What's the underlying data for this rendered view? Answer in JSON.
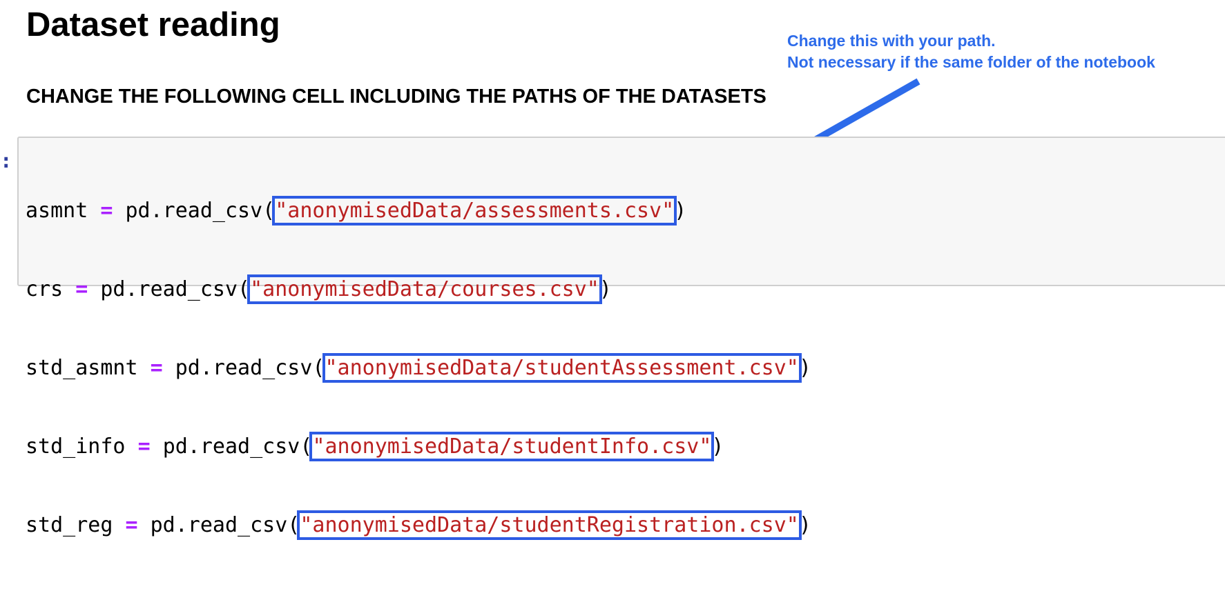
{
  "heading": "Dataset reading",
  "subheading": "CHANGE THE FOLLOWING CELL INCLUDING THE PATHS OF THE DATASETS",
  "annotation": {
    "line1": "Change this with your path.",
    "line2": "Not necessary if the same folder of the notebook",
    "color": "#2D6BEA"
  },
  "cell": {
    "prompt": ":",
    "lines": [
      {
        "var": "asmnt",
        "op": "=",
        "call": "pd.read_csv(",
        "path": "\"anonymisedData/assessments.csv\"",
        "close": ")"
      },
      {
        "var": "crs",
        "op": "=",
        "call": "pd.read_csv(",
        "path": "\"anonymisedData/courses.csv\"",
        "close": ")"
      },
      {
        "var": "std_asmnt",
        "op": "=",
        "call": "pd.read_csv(",
        "path": "\"anonymisedData/studentAssessment.csv\"",
        "close": ")"
      },
      {
        "var": "std_info",
        "op": "=",
        "call": "pd.read_csv(",
        "path": "\"anonymisedData/studentInfo.csv\"",
        "close": ")"
      },
      {
        "var": "std_reg",
        "op": "=",
        "call": "pd.read_csv(",
        "path": "\"anonymisedData/studentRegistration.csv\"",
        "close": ")"
      }
    ]
  },
  "colors": {
    "highlight_box": "#2D5BE3",
    "string": "#BA2121",
    "operator": "#AA22FF",
    "arrow": "#2D6BEA"
  },
  "icons": {
    "annotation_arrow": "arrow-icon"
  }
}
